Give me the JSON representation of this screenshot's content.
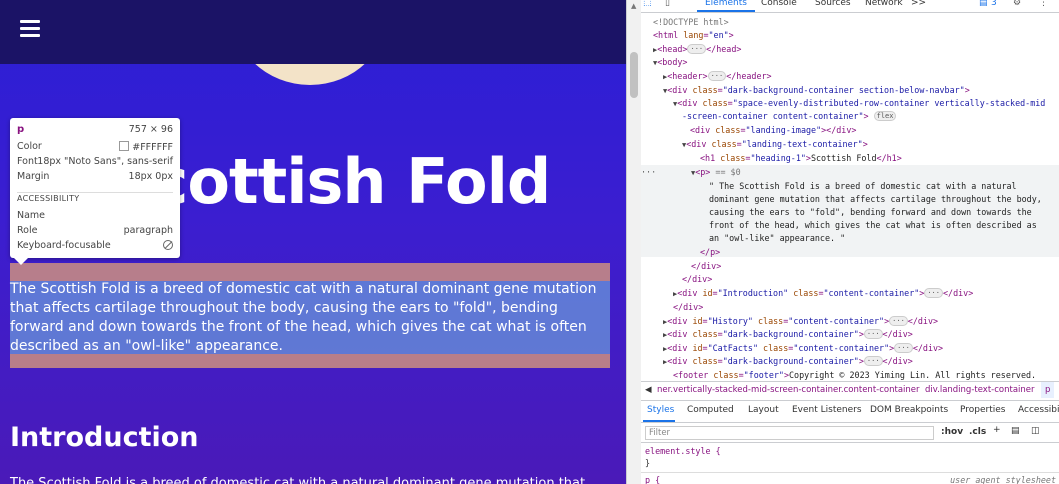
{
  "page": {
    "heading": "Scottish Fold",
    "paragraph": "The Scottish Fold is a breed of domestic cat with a natural dominant gene mutation that affects cartilage throughout the body, causing the ears to \"fold\", bending forward and down towards the front of the head, which gives the cat what is often described as an \"owl-like\" appearance.",
    "intro_heading": "Introduction",
    "intro_text": "The Scottish Fold is a breed of domestic cat with a natural dominant gene mutation that"
  },
  "tooltip": {
    "tag": "p",
    "size": "757 × 96",
    "color_label": "Color",
    "color_value": "#FFFFFF",
    "font_label": "Font",
    "font_value": "18px \"Noto Sans\", sans-serif",
    "margin_label": "Margin",
    "margin_value": "18px 0px",
    "accessibility_heading": "ACCESSIBILITY",
    "name_label": "Name",
    "role_label": "Role",
    "role_value": "paragraph",
    "keyboard_label": "Keyboard-focusable"
  },
  "devtools": {
    "tabs": [
      "Elements",
      "Console",
      "Sources",
      "Network",
      ">>"
    ],
    "issues_count": "3",
    "dom": {
      "doctype": "<!DOCTYPE html>",
      "html_open": "<html",
      "html_attr": "lang",
      "html_val": "\"en\"",
      "head": "<head>",
      "head_close": "</head>",
      "body": "<body>",
      "header": "<header>",
      "header_close": "</header>",
      "div": "<div",
      "div_close": "</div>",
      "class_attr": "class",
      "id_attr": "id",
      "section_val": "\"dark-background-container section-below-navbar\"",
      "space_val_1": "\"space-evenly-distributed-row-container vertically-stacked-mid",
      "space_val_2": "-screen-container content-container\"",
      "flex_badge": "flex",
      "landing_image": "\"landing-image\"",
      "landing_text": "\"landing-text-container\"",
      "h1": "<h1",
      "h1_class": "\"heading-1\"",
      "h1_text": "Scottish Fold",
      "h1_close": "</h1>",
      "p_open": "<p>",
      "p_marker": "== $0",
      "p_text_1": "\" The Scottish Fold is a breed of domestic cat with a natural",
      "p_text_2": "dominant gene mutation that affects cartilage throughout the body,",
      "p_text_3": "causing the ears to \"fold\", bending forward and down towards the",
      "p_text_4": "front of the head, which gives the cat what is often described as",
      "p_text_5": "an \"owl-like\" appearance. \"",
      "p_close": "</p>",
      "intro_id": "\"Introduction\"",
      "content_container": "\"content-container\"",
      "history_id": "\"History\"",
      "dark_bg": "\"dark-background-container\"",
      "catfacts_id": "\"CatFacts\"",
      "footer": "<footer",
      "footer_class": "\"footer\"",
      "footer_text": "Copyright © 2023 Yiming Lin. All rights reserved."
    },
    "breadcrumb": {
      "item_1": "ner.vertically-stacked-mid-screen-container.content-container",
      "item_2": "div.landing-text-container",
      "item_3": "p"
    },
    "styles_tabs": [
      "Styles",
      "Computed",
      "Layout",
      "Event Listeners",
      "DOM Breakpoints",
      "Properties",
      "Accessibility"
    ],
    "filter_placeholder": "Filter",
    "hov": ":hov",
    "cls": ".cls",
    "element_style": "element.style {",
    "close_brace": "}",
    "p_rule": "p {",
    "ua_stylesheet": "user agent stylesheet"
  },
  "colors": {
    "accent": "#1a73e8",
    "navbar": "#1b1366",
    "page_bg": "#2a1fd6"
  }
}
